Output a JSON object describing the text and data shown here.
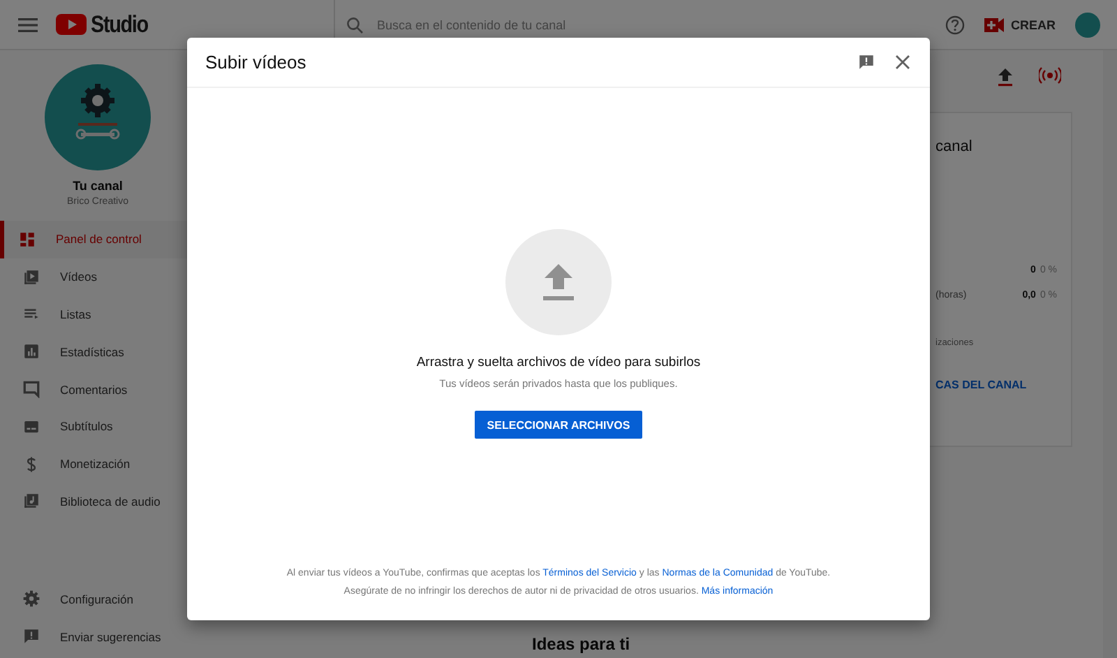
{
  "header": {
    "title": "Studio",
    "search_placeholder": "Busca en el contenido de tu canal",
    "create_label": "CREAR"
  },
  "channel": {
    "name": "Tu canal",
    "subtitle": "Brico Creativo"
  },
  "sidebar": {
    "items": [
      {
        "kind": "dashboard",
        "label": "Panel de control",
        "selected": true
      },
      {
        "kind": "videos",
        "label": "Vídeos",
        "selected": false
      },
      {
        "kind": "playlists",
        "label": "Listas",
        "selected": false
      },
      {
        "kind": "analytics",
        "label": "Estadísticas",
        "selected": false
      },
      {
        "kind": "comments",
        "label": "Comentarios",
        "selected": false
      },
      {
        "kind": "subtitles",
        "label": "Subtítulos",
        "selected": false
      },
      {
        "kind": "money",
        "label": "Monetización",
        "selected": false
      },
      {
        "kind": "audio",
        "label": "Biblioteca de audio",
        "selected": false
      }
    ],
    "footer_items": [
      {
        "kind": "settings",
        "label": "Configuración",
        "selected": false
      },
      {
        "kind": "feedback",
        "label": "Enviar sugerencias",
        "selected": false
      }
    ]
  },
  "analytics_card": {
    "title": "canal",
    "rows": [
      {
        "label": "",
        "value": "0",
        "change": "0 %"
      },
      {
        "label": "(horas)",
        "value": "0,0",
        "change": "0 %"
      }
    ],
    "note": "izaciones",
    "link": "CAS DEL CANAL"
  },
  "ideas_title": "Ideas para ti",
  "dialog": {
    "title": "Subir vídeos",
    "prompt": "Arrastra y suelta archivos de vídeo para subirlos",
    "hint": "Tus vídeos serán privados hasta que los publiques.",
    "button": "SELECCIONAR ARCHIVOS",
    "footer_lines": [
      [
        {
          "kind": "text",
          "text": "Al enviar tus vídeos a YouTube, confirmas que aceptas los "
        },
        {
          "kind": "link",
          "text": "Términos del Servicio"
        },
        {
          "kind": "text",
          "text": " y las "
        },
        {
          "kind": "link",
          "text": "Normas de la Comunidad"
        },
        {
          "kind": "text",
          "text": " de YouTube."
        }
      ],
      [
        {
          "kind": "text",
          "text": "Asegúrate de no infringir los derechos de autor ni de privacidad de otros usuarios. "
        },
        {
          "kind": "link",
          "text": "Más información"
        }
      ]
    ]
  }
}
